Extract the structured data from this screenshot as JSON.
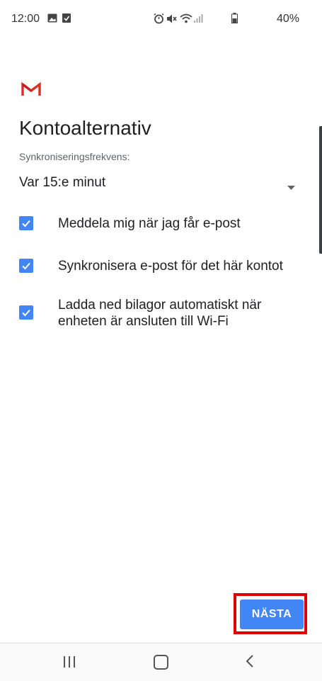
{
  "status_bar": {
    "time": "12:00",
    "battery_percent": "40%",
    "icons": [
      "image-icon",
      "download-check-icon",
      "alarm-icon",
      "mute-icon",
      "wifi-icon",
      "signal-icon",
      "battery-icon"
    ]
  },
  "app": {
    "logo": "gmail-logo",
    "title": "Kontoalternativ"
  },
  "sync": {
    "label": "Synkroniseringsfrekvens:",
    "value": "Var 15:e minut"
  },
  "options": [
    {
      "label": "Meddela mig när jag får e-post",
      "checked": true
    },
    {
      "label": "Synkronisera e-post för det här kontot",
      "checked": true
    },
    {
      "label": "Ladda ned bilagor automatiskt när enheten är ansluten till Wi-Fi",
      "checked": true
    }
  ],
  "actions": {
    "next_label": "NÄSTA",
    "highlight_color": "#e00000",
    "button_color": "#4285f4"
  },
  "nav_bar": {
    "icons": [
      "recent-apps-icon",
      "home-icon",
      "back-icon"
    ]
  }
}
